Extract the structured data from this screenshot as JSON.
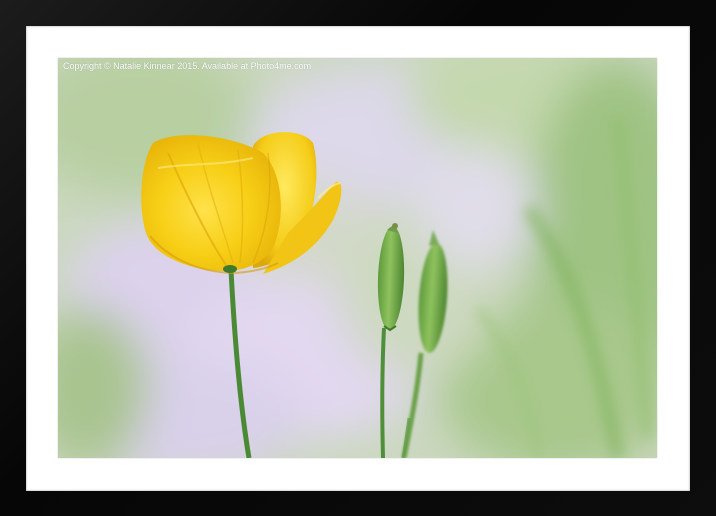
{
  "photo": {
    "copyright": "Copyright © Natalie Kinnear 2015. Available at Photo4me.com"
  },
  "colors": {
    "frame": "#0a0a0a",
    "mount": "#ffffff",
    "petal": "#f5d21a",
    "stem": "#4f8f3a",
    "background_green": "#a9c98f",
    "background_lilac": "#d9d2ea"
  }
}
